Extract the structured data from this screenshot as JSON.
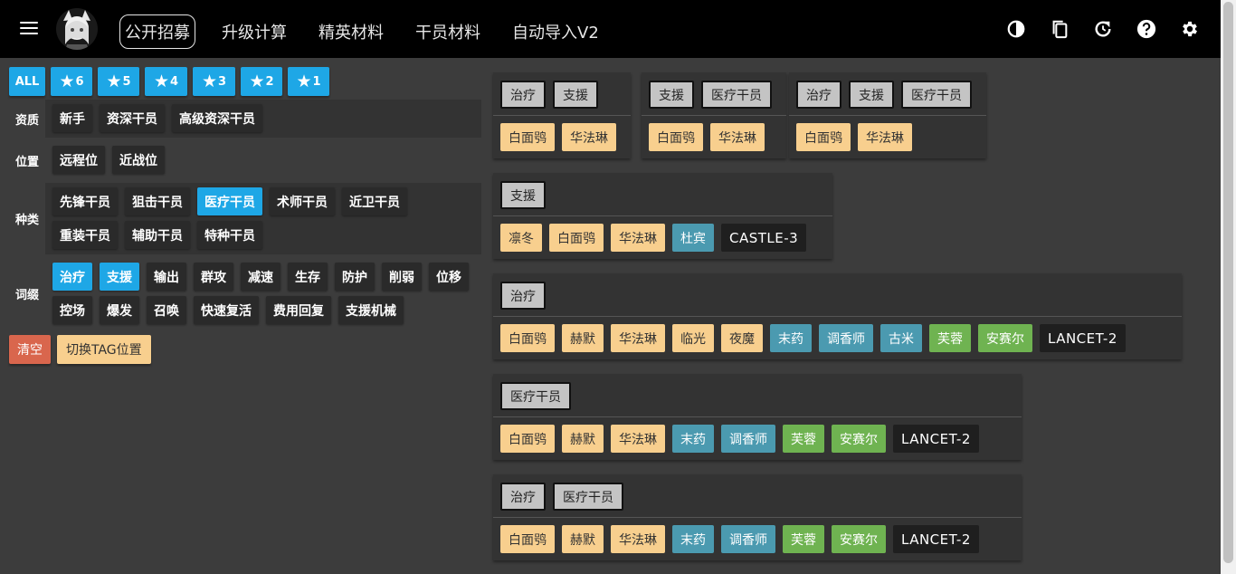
{
  "nav": {
    "items": [
      {
        "label": "公开招募",
        "active": true
      },
      {
        "label": "升级计算",
        "active": false
      },
      {
        "label": "精英材料",
        "active": false
      },
      {
        "label": "干员材料",
        "active": false
      },
      {
        "label": "自动导入V2",
        "active": false
      }
    ],
    "icons": [
      "dark-mode-icon",
      "copy-icon",
      "refresh-icon",
      "help-icon",
      "settings-icon"
    ]
  },
  "stars": {
    "all_label": "ALL",
    "levels": [
      "6",
      "5",
      "4",
      "3",
      "2",
      "1"
    ]
  },
  "filters": {
    "qualification": {
      "label": "资质",
      "tags": [
        "新手",
        "资深干员",
        "高级资深干员"
      ]
    },
    "position": {
      "label": "位置",
      "tags": [
        "远程位",
        "近战位"
      ]
    },
    "class": {
      "label": "种类",
      "tags": [
        "先锋干员",
        "狙击干员",
        "医疗干员",
        "术师干员",
        "近卫干员",
        "重装干员",
        "辅助干员",
        "特种干员"
      ]
    },
    "affix": {
      "label": "词缀",
      "tags": [
        "治疗",
        "支援",
        "输出",
        "群攻",
        "减速",
        "生存",
        "防护",
        "削弱",
        "位移",
        "控场",
        "爆发",
        "召唤",
        "快速复活",
        "费用回复",
        "支援机械"
      ]
    }
  },
  "actions": {
    "clear_label": "清空",
    "switch_label": "切换TAG位置"
  },
  "results": [
    {
      "tags": [
        "治疗",
        "支援"
      ],
      "ops": [
        {
          "name": "白面鸮",
          "rarity": 4
        },
        {
          "name": "华法琳",
          "rarity": 4
        }
      ]
    },
    {
      "tags": [
        "支援",
        "医疗干员"
      ],
      "ops": [
        {
          "name": "白面鸮",
          "rarity": 4
        },
        {
          "name": "华法琳",
          "rarity": 4
        }
      ]
    },
    {
      "tags": [
        "治疗",
        "支援",
        "医疗干员"
      ],
      "ops": [
        {
          "name": "白面鸮",
          "rarity": 4
        },
        {
          "name": "华法琳",
          "rarity": 4
        }
      ]
    },
    {
      "tags": [
        "支援"
      ],
      "ops": [
        {
          "name": "凛冬",
          "rarity": 4
        },
        {
          "name": "白面鸮",
          "rarity": 4
        },
        {
          "name": "华法琳",
          "rarity": 4
        },
        {
          "name": "杜宾",
          "rarity": 3
        },
        {
          "name": "CASTLE-3",
          "rarity": 1
        }
      ]
    },
    {
      "tags": [
        "治疗"
      ],
      "ops": [
        {
          "name": "白面鸮",
          "rarity": 4
        },
        {
          "name": "赫默",
          "rarity": 4
        },
        {
          "name": "华法琳",
          "rarity": 4
        },
        {
          "name": "临光",
          "rarity": 4
        },
        {
          "name": "夜魔",
          "rarity": 4
        },
        {
          "name": "末药",
          "rarity": 3
        },
        {
          "name": "调香师",
          "rarity": 3
        },
        {
          "name": "古米",
          "rarity": 3
        },
        {
          "name": "芙蓉",
          "rarity": 2
        },
        {
          "name": "安赛尔",
          "rarity": 2
        },
        {
          "name": "LANCET-2",
          "rarity": 1
        }
      ]
    },
    {
      "tags": [
        "医疗干员"
      ],
      "ops": [
        {
          "name": "白面鸮",
          "rarity": 4
        },
        {
          "name": "赫默",
          "rarity": 4
        },
        {
          "name": "华法琳",
          "rarity": 4
        },
        {
          "name": "末药",
          "rarity": 3
        },
        {
          "name": "调香师",
          "rarity": 3
        },
        {
          "name": "芙蓉",
          "rarity": 2
        },
        {
          "name": "安赛尔",
          "rarity": 2
        },
        {
          "name": "LANCET-2",
          "rarity": 1
        }
      ]
    },
    {
      "tags": [
        "治疗",
        "医疗干员"
      ],
      "ops": [
        {
          "name": "白面鸮",
          "rarity": 4
        },
        {
          "name": "赫默",
          "rarity": 4
        },
        {
          "name": "华法琳",
          "rarity": 4
        },
        {
          "name": "末药",
          "rarity": 3
        },
        {
          "name": "调香师",
          "rarity": 3
        },
        {
          "name": "芙蓉",
          "rarity": 2
        },
        {
          "name": "安赛尔",
          "rarity": 2
        },
        {
          "name": "LANCET-2",
          "rarity": 1
        }
      ]
    }
  ],
  "colors": {
    "accent": "#1ea7e6",
    "rarity4": "#f8cf8e",
    "rarity3": "#4b9ab0",
    "rarity2": "#6fb351",
    "rarity1": "#1f1f1f"
  }
}
